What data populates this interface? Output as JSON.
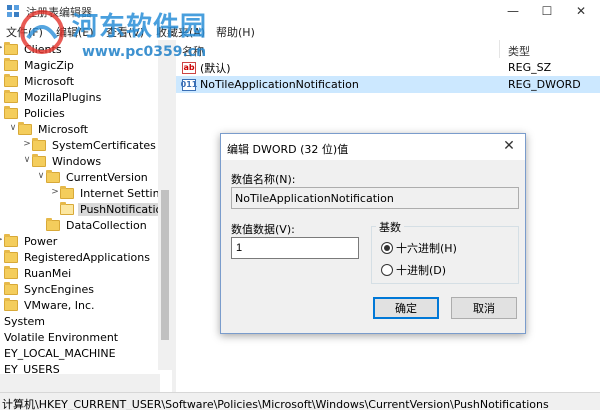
{
  "window": {
    "title": "注册表编辑器",
    "min_glyph": "—",
    "max_glyph": "☐",
    "close_glyph": "✕"
  },
  "watermark": {
    "title": "河东软件园",
    "url": "www.pc0359.cn"
  },
  "menu": [
    "文件(F)",
    "编辑(E)",
    "查看(V)",
    "收藏夹(A)",
    "帮助(H)"
  ],
  "tree": {
    "items": [
      {
        "label": "Clients",
        "expander": ">",
        "indent": 0
      },
      {
        "label": "MagicZip",
        "expander": "",
        "indent": 0
      },
      {
        "label": "Microsoft",
        "expander": "",
        "indent": 0
      },
      {
        "label": "MozillaPlugins",
        "expander": "",
        "indent": 0
      },
      {
        "label": "Policies",
        "expander": "",
        "indent": 0
      },
      {
        "label": "Microsoft",
        "expander": "∨",
        "indent": 1
      },
      {
        "label": "SystemCertificates",
        "expander": ">",
        "indent": 2
      },
      {
        "label": "Windows",
        "expander": "∨",
        "indent": 2
      },
      {
        "label": "CurrentVersion",
        "expander": "∨",
        "indent": 3
      },
      {
        "label": "Internet Settings",
        "expander": ">",
        "indent": 4
      },
      {
        "label": "PushNotifications",
        "expander": "",
        "indent": 4,
        "selected": true
      },
      {
        "label": "DataCollection",
        "expander": "",
        "indent": 3
      },
      {
        "label": "Power",
        "expander": ">",
        "indent": 0
      },
      {
        "label": "RegisteredApplications",
        "expander": "",
        "indent": 0
      },
      {
        "label": "RuanMei",
        "expander": "",
        "indent": 0
      },
      {
        "label": "SyncEngines",
        "expander": "",
        "indent": 0
      },
      {
        "label": "VMware, Inc.",
        "expander": "",
        "indent": 0
      },
      {
        "label": "System",
        "expander": "",
        "indent": -1
      },
      {
        "label": "Volatile Environment",
        "expander": "",
        "indent": -1
      },
      {
        "label": "EY_LOCAL_MACHINE",
        "expander": "",
        "indent": -1
      },
      {
        "label": "EY_USERS",
        "expander": "",
        "indent": -1
      }
    ]
  },
  "list": {
    "col_name": "名称",
    "col_type": "类型",
    "rows": [
      {
        "icon": "ab",
        "name": "(默认)",
        "type": "REG_SZ"
      },
      {
        "icon": "bin",
        "name": "NoTileApplicationNotification",
        "type": "REG_DWORD",
        "selected": true
      }
    ]
  },
  "status": {
    "path": "计算机\\HKEY_CURRENT_USER\\Software\\Policies\\Microsoft\\Windows\\CurrentVersion\\PushNotifications"
  },
  "dialog": {
    "title": "编辑 DWORD (32 位)值",
    "close_glyph": "✕",
    "value_name_label": "数值名称(N):",
    "value_name": "NoTileApplicationNotification",
    "value_data_label": "数值数据(V):",
    "value_data": "1",
    "base_label": "基数",
    "hex_label": "十六进制(H)",
    "dec_label": "十进制(D)",
    "ok_label": "确定",
    "cancel_label": "取消"
  }
}
